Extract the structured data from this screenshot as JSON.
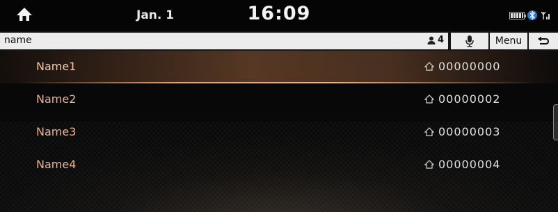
{
  "status": {
    "date": "Jan. 1",
    "time": "16:09",
    "icons": [
      "home-icon",
      "battery-icon",
      "bluetooth-icon",
      "signal-icon"
    ]
  },
  "search": {
    "value": "name",
    "result_count": "4",
    "icons": [
      "person-icon",
      "microphone-icon",
      "back-arrow-icon"
    ],
    "menu_label": "Menu"
  },
  "contacts": [
    {
      "name": "Name1",
      "number": "00000000",
      "type_icon": "home-icon",
      "selected": true
    },
    {
      "name": "Name2",
      "number": "00000002",
      "type_icon": "home-icon",
      "selected": false
    },
    {
      "name": "Name3",
      "number": "00000003",
      "type_icon": "home-icon",
      "selected": false
    },
    {
      "name": "Name4",
      "number": "00000004",
      "type_icon": "home-icon",
      "selected": false
    }
  ],
  "colors": {
    "name_text": "#e7b390",
    "selection_glow": "#e9a070",
    "search_bg": "#ececec"
  }
}
